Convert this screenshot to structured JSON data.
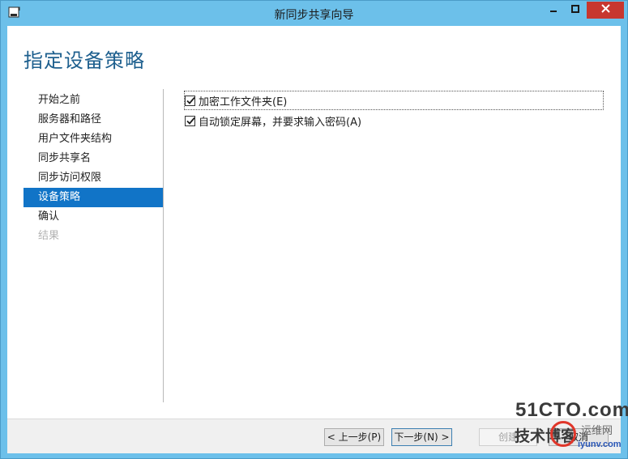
{
  "window": {
    "title": "新同步共享向导",
    "title_icon": "wizard-app-icon",
    "controls": [
      "minimize-icon",
      "maximize-icon",
      "close-icon"
    ]
  },
  "page": {
    "heading": "指定设备策略"
  },
  "steps": [
    {
      "label": "开始之前",
      "state": "normal"
    },
    {
      "label": "服务器和路径",
      "state": "normal"
    },
    {
      "label": "用户文件夹结构",
      "state": "normal"
    },
    {
      "label": "同步共享名",
      "state": "normal"
    },
    {
      "label": "同步访问权限",
      "state": "normal"
    },
    {
      "label": "设备策略",
      "state": "active"
    },
    {
      "label": "确认",
      "state": "normal"
    },
    {
      "label": "结果",
      "state": "disabled"
    }
  ],
  "options": [
    {
      "label": "加密工作文件夹(E)",
      "checked": true,
      "focused": true
    },
    {
      "label": "自动锁定屏幕，并要求输入密码(A)",
      "checked": true,
      "focused": false
    }
  ],
  "buttons": {
    "prev": "< 上一步(P)",
    "next": "下一步(N) >",
    "create": "创建",
    "cancel": "取消"
  },
  "watermark": {
    "brand": "51CTO.com",
    "tagline": "技术博客",
    "site_name": "运维网",
    "url": "iyunv.com"
  },
  "colors": {
    "accent": "#1174c7",
    "heading": "#1d5f8e",
    "frame": "#6cc0ea",
    "close": "#c7372f"
  }
}
